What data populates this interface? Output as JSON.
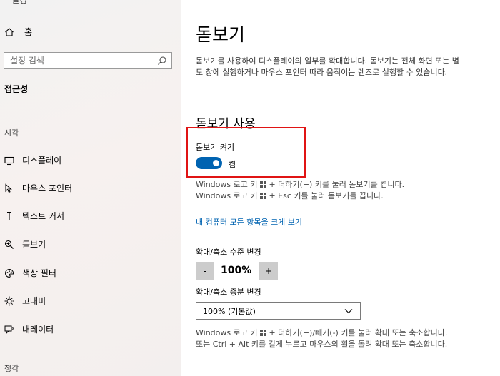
{
  "sidebar": {
    "cut_title": "설정",
    "home_label": "홈",
    "search_placeholder": "설정 검색",
    "section_title": "접근성",
    "group_vision": "시각",
    "items": [
      {
        "label": "디스플레이",
        "icon": "display-icon"
      },
      {
        "label": "마우스 포인터",
        "icon": "mouse-pointer-icon"
      },
      {
        "label": "텍스트 커서",
        "icon": "text-cursor-icon"
      },
      {
        "label": "돋보기",
        "icon": "magnifier-icon"
      },
      {
        "label": "색상 필터",
        "icon": "color-filter-icon"
      },
      {
        "label": "고대비",
        "icon": "high-contrast-icon"
      },
      {
        "label": "내레이터",
        "icon": "narrator-icon"
      }
    ],
    "group_hearing": "청각"
  },
  "main": {
    "title": "돋보기",
    "description": "돋보기를 사용하여 디스플레이의 일부를 확대합니다. 돋보기는 전체 화면 또는 별도 창에 실행하거나 마우스 포인터 따라 움직이는 렌즈로 실행할 수 있습니다.",
    "section_title": "돋보기 사용",
    "toggle": {
      "label": "돋보기 켜기",
      "state": "켬",
      "on": true
    },
    "hint1_pre": "Windows 로고 키",
    "hint1_post": "+ 더하기(+) 키를 눌러 돋보기를 켭니다.",
    "hint2_pre": "Windows 로고 키",
    "hint2_post": "+ Esc 키를 눌러 돋보기를 끕니다.",
    "link": "내 컴퓨터 모든 항목을 크게 보기",
    "zoom_label": "확대/축소 수준 변경",
    "zoom_minus": "-",
    "zoom_value": "100%",
    "zoom_plus": "+",
    "increment_label": "확대/축소 증분 변경",
    "increment_value": "100% (기본값)",
    "footer_line1_pre": "Windows 로고 키",
    "footer_line1_post": "+ 더하기(+)/빼기(-) 키를 눌러 확대 또는 축소합니다.",
    "footer_line2": "또는 Ctrl + Alt 키를 길게 누르고 마우스의 휠을 돌려 확대 또는 축소합니다."
  },
  "colors": {
    "accent": "#0063b1",
    "highlight_border": "#e01414",
    "sidebar_bg": "#f3f0ef"
  }
}
